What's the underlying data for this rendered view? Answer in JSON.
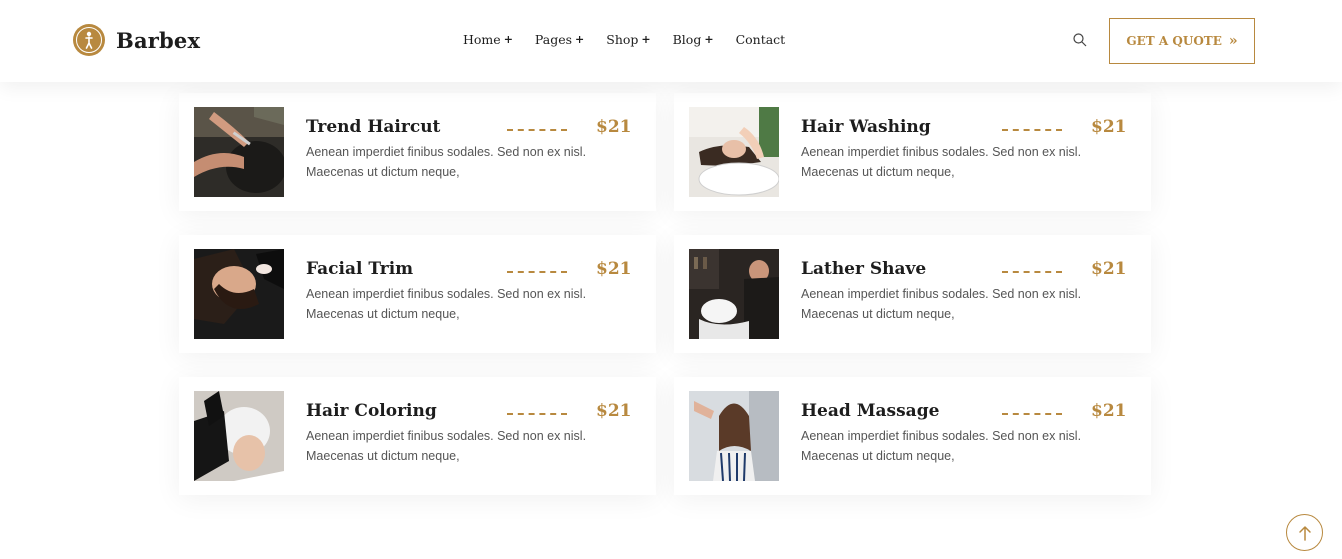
{
  "brand": {
    "name": "Barbex",
    "accent": "#b8893f"
  },
  "nav": {
    "items": [
      {
        "label": "Home",
        "has_submenu": true
      },
      {
        "label": "Pages",
        "has_submenu": true
      },
      {
        "label": "Shop",
        "has_submenu": true
      },
      {
        "label": "Blog",
        "has_submenu": true
      },
      {
        "label": "Contact",
        "has_submenu": false
      }
    ],
    "submenu_glyph": "+",
    "search_icon": "search-icon",
    "quote_label": "GET A QUOTE",
    "quote_arrow": "»"
  },
  "services": [
    {
      "title": "Trend Haircut",
      "price": "$21",
      "desc": "Aenean imperdiet finibus sodales. Sed non ex nisl. Maecenas ut dictum neque,",
      "image": "haircut-photo"
    },
    {
      "title": "Hair Washing",
      "price": "$21",
      "desc": "Aenean imperdiet finibus sodales. Sed non ex nisl. Maecenas ut dictum neque,",
      "image": "hair-washing-photo"
    },
    {
      "title": "Facial Trim",
      "price": "$21",
      "desc": "Aenean imperdiet finibus sodales. Sed non ex nisl. Maecenas ut dictum neque,",
      "image": "facial-trim-photo"
    },
    {
      "title": "Lather Shave",
      "price": "$21",
      "desc": "Aenean imperdiet finibus sodales. Sed non ex nisl. Maecenas ut dictum neque,",
      "image": "lather-shave-photo"
    },
    {
      "title": "Hair Coloring",
      "price": "$21",
      "desc": "Aenean imperdiet finibus sodales. Sed non ex nisl. Maecenas ut dictum neque,",
      "image": "hair-coloring-photo"
    },
    {
      "title": "Head Massage",
      "price": "$21",
      "desc": "Aenean imperdiet finibus sodales. Sed non ex nisl. Maecenas ut dictum neque,",
      "image": "head-massage-photo"
    }
  ],
  "scroll_top_icon": "arrow-up-icon"
}
